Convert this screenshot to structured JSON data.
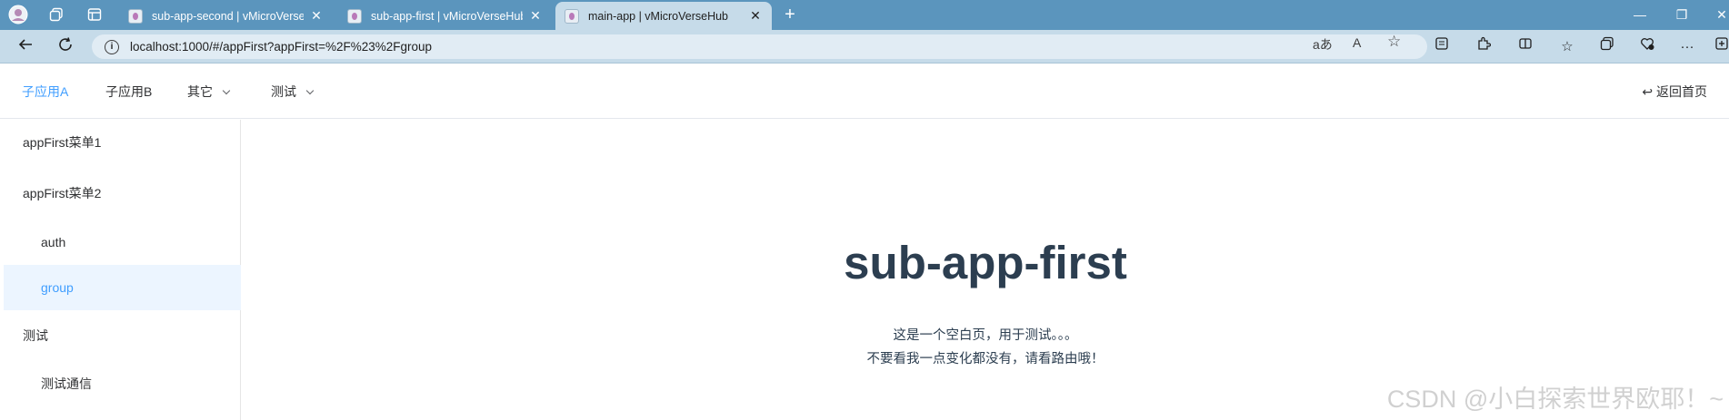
{
  "browser": {
    "tabs": [
      {
        "title": "sub-app-second | vMicroVerseHub",
        "active": false
      },
      {
        "title": "sub-app-first | vMicroVerseHub",
        "active": false
      },
      {
        "title": "main-app | vMicroVerseHub",
        "active": true
      }
    ],
    "new_tab_glyph": "+",
    "address": "localhost:1000/#/appFirst?appFirst=%2F%23%2Fgroup",
    "read_aloud_glyph": "aあ",
    "font_glyph": "A"
  },
  "header": {
    "nav": [
      {
        "label": "子应用A",
        "active": true,
        "dropdown": false
      },
      {
        "label": "子应用B",
        "active": false,
        "dropdown": false
      },
      {
        "label": "其它",
        "active": false,
        "dropdown": true
      },
      {
        "label": "测试",
        "active": false,
        "dropdown": true
      }
    ],
    "back_home": "↩ 返回首页"
  },
  "sidebar": {
    "items": [
      {
        "label": "appFirst菜单1",
        "level": 1,
        "active": false
      },
      {
        "label": "appFirst菜单2",
        "level": 1,
        "active": false
      },
      {
        "label": "auth",
        "level": 2,
        "active": false
      },
      {
        "label": "group",
        "level": 2,
        "active": true
      },
      {
        "label": "测试",
        "level": 1,
        "active": false
      },
      {
        "label": "测试通信",
        "level": 2,
        "active": false
      }
    ]
  },
  "main": {
    "title": "sub-app-first",
    "line1": "这是一个空白页，用于测试。。。",
    "line2": "不要看我一点变化都没有，请看路由哦！"
  },
  "watermark": "CSDN @小白探索世界欧耶！~",
  "colors": {
    "accent": "#409eff",
    "tabstrip": "#5b95bd",
    "toolbar": "#c6dbe9",
    "text": "#2c3e50",
    "active_bg": "#ecf5ff"
  }
}
